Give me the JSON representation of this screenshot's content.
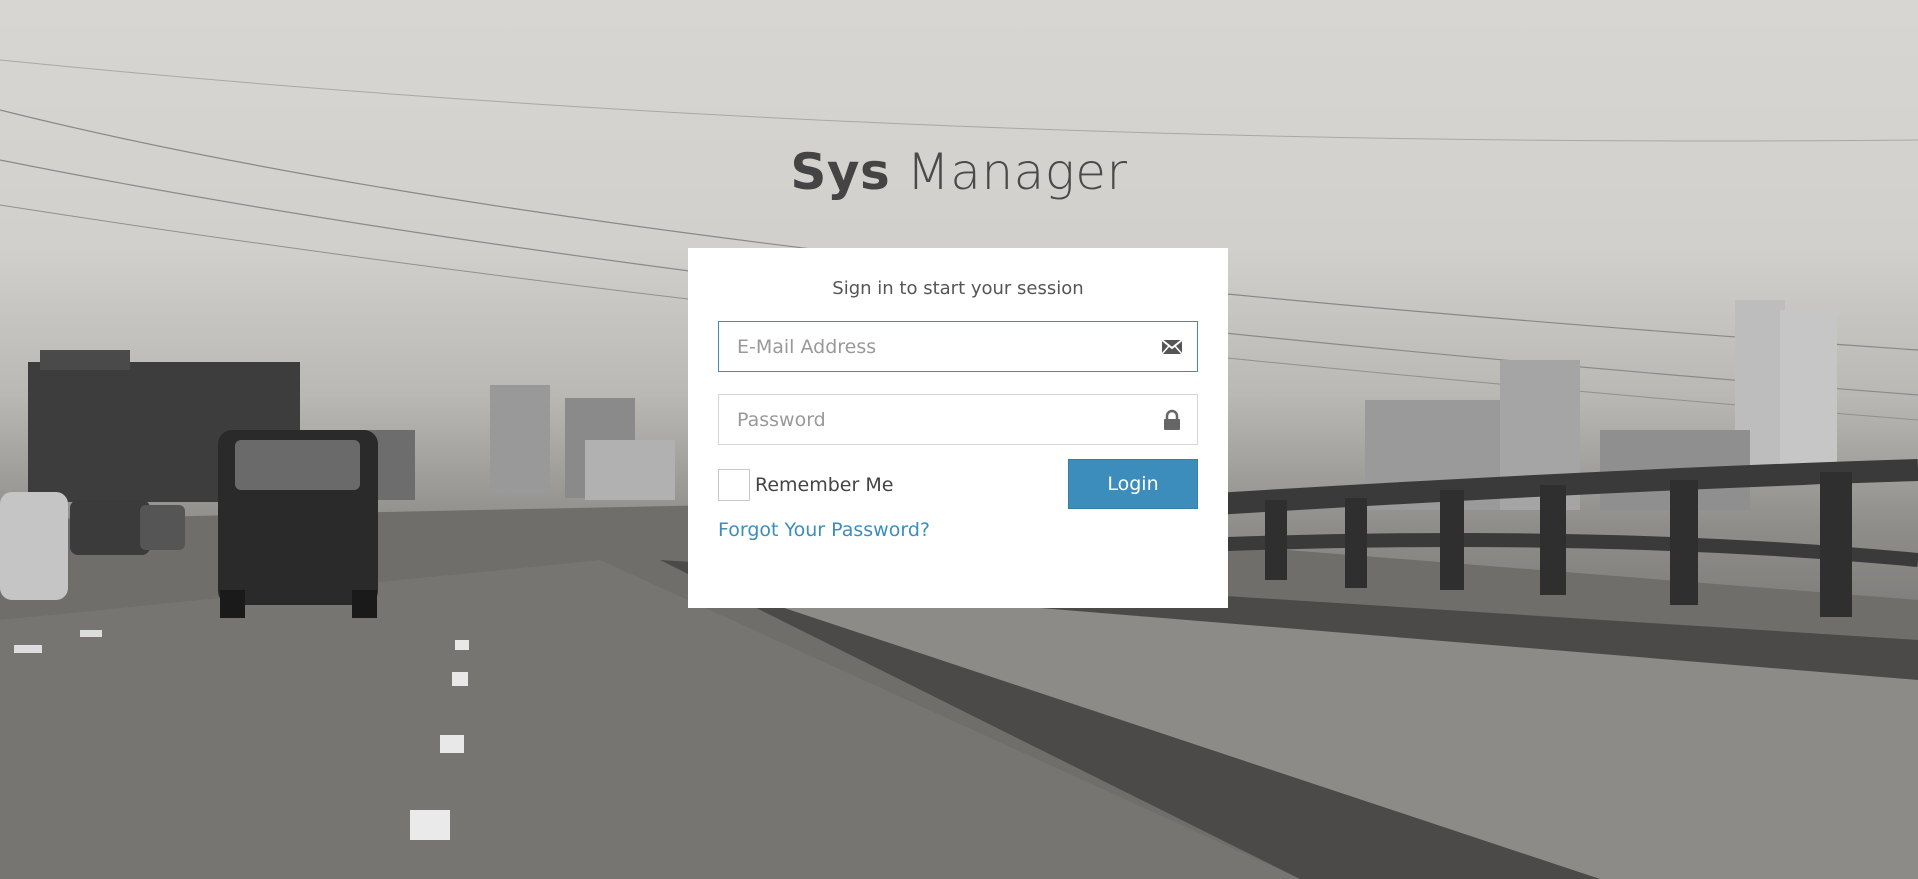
{
  "brand": {
    "bold": "Sys",
    "light": "Manager"
  },
  "login_box": {
    "message": "Sign in to start your session",
    "email": {
      "value": "",
      "placeholder": "E-Mail Address",
      "icon": "envelope-icon"
    },
    "password": {
      "value": "",
      "placeholder": "Password",
      "icon": "lock-icon"
    },
    "remember_label": "Remember Me",
    "remember_checked": false,
    "login_label": "Login",
    "forgot_label": "Forgot Your Password?"
  },
  "colors": {
    "accent": "#3c8dbc",
    "input_border": "#d2d6de"
  }
}
